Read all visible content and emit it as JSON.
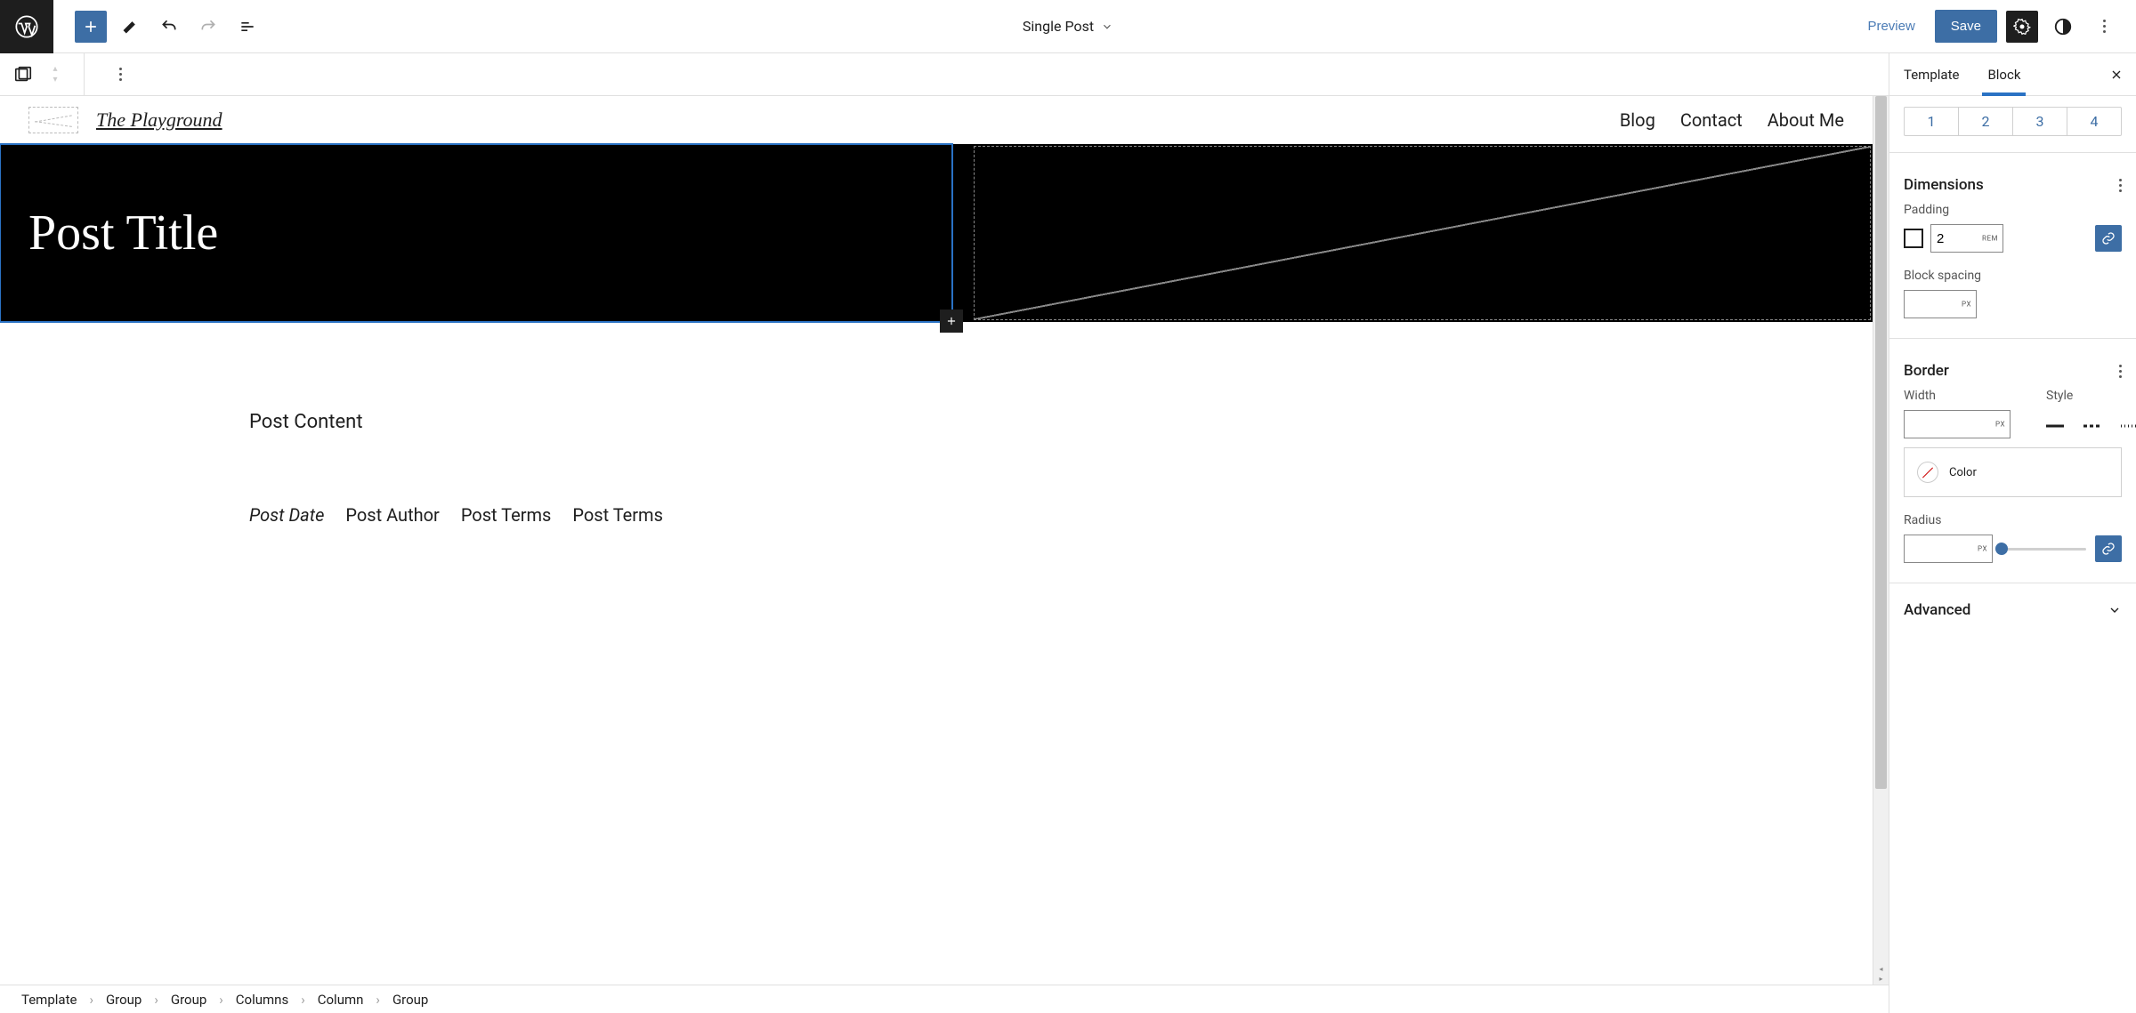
{
  "toolbar": {
    "document_title": "Single Post",
    "preview_label": "Preview",
    "save_label": "Save"
  },
  "site": {
    "title": "The Playground",
    "nav": {
      "item0": "Blog",
      "item1": "Contact",
      "item2": "About Me"
    }
  },
  "canvas": {
    "post_title": "Post Title",
    "post_content": "Post Content",
    "meta": {
      "date": "Post Date",
      "author": "Post Author",
      "terms1": "Post Terms",
      "terms2": "Post Terms"
    }
  },
  "sidebar": {
    "tabs": {
      "template": "Template",
      "block": "Block"
    },
    "levels": {
      "l1": "1",
      "l2": "2",
      "l3": "3",
      "l4": "4"
    },
    "dimensions": {
      "title": "Dimensions",
      "padding_label": "Padding",
      "padding_value": "2",
      "padding_unit": "REM",
      "spacing_label": "Block spacing",
      "spacing_value": "",
      "spacing_unit": "PX"
    },
    "border": {
      "title": "Border",
      "width_label": "Width",
      "width_value": "",
      "width_unit": "PX",
      "style_label": "Style",
      "color_label": "Color",
      "radius_label": "Radius",
      "radius_value": "",
      "radius_unit": "PX"
    },
    "advanced_title": "Advanced"
  },
  "breadcrumb": {
    "c0": "Template",
    "c1": "Group",
    "c2": "Group",
    "c3": "Columns",
    "c4": "Column",
    "c5": "Group"
  }
}
